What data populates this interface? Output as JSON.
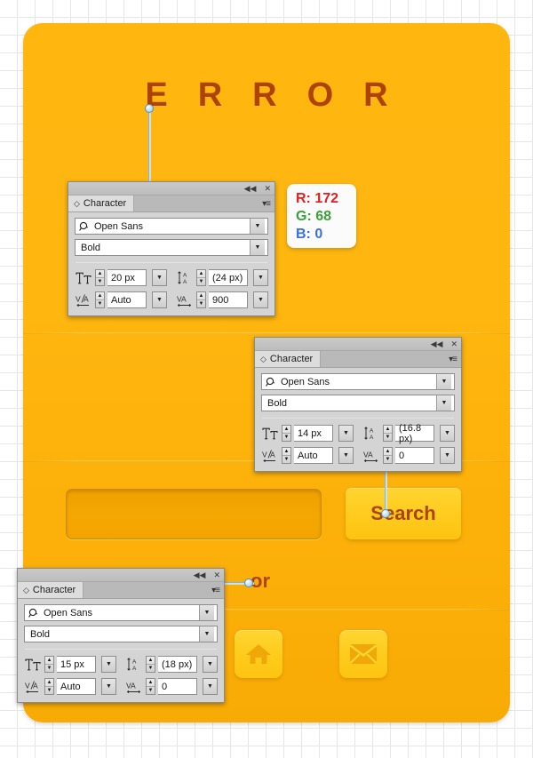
{
  "canvas": {
    "grid_enabled": true,
    "grid_size_px": 20,
    "background": "#ffffff",
    "grid_color": "#e6e6e6"
  },
  "card": {
    "background_color": "#ffb710",
    "accent_text_color": "#ac4400",
    "button_color": "#ffcb1d"
  },
  "error": {
    "heading": "ERROR"
  },
  "rgb_swatch": {
    "r_label": "R: 172",
    "g_label": "G: 68",
    "b_label": "B: 0",
    "r_color": "#e02020",
    "g_color": "#3aa03a",
    "b_color": "#3a6fe0",
    "hex": "#ac4400"
  },
  "search": {
    "input_value": "",
    "input_placeholder": "",
    "button_label": "Search"
  },
  "or_label": "or",
  "icon_tiles": [
    {
      "name": "home-icon",
      "label": "Home"
    },
    {
      "name": "envelope-icon",
      "label": "Email"
    }
  ],
  "panels": [
    {
      "title": "Character",
      "collapse_icon": "◀◀",
      "close_icon": "✕",
      "menu_icon": "▾≡",
      "tab_diamond": "◇",
      "font_family": "Open Sans",
      "font_style": "Bold",
      "font_size": "20 px",
      "leading": "(24 px)",
      "kerning": "Auto",
      "tracking": "900",
      "size_icon": "TT",
      "leading_icon": "A̲A",
      "kerning_icon": "V/A",
      "tracking_icon": "VA",
      "dropdown_arrow": "▼",
      "spin_up": "▲",
      "spin_down": "▼",
      "search_glyph": "⚲"
    },
    {
      "title": "Character",
      "collapse_icon": "◀◀",
      "close_icon": "✕",
      "menu_icon": "▾≡",
      "tab_diamond": "◇",
      "font_family": "Open Sans",
      "font_style": "Bold",
      "font_size": "14 px",
      "leading": "(16.8 px)",
      "kerning": "Auto",
      "tracking": "0",
      "size_icon": "TT",
      "leading_icon": "A̲A",
      "kerning_icon": "V/A",
      "tracking_icon": "VA",
      "dropdown_arrow": "▼",
      "spin_up": "▲",
      "spin_down": "▼",
      "search_glyph": "⚲"
    },
    {
      "title": "Character",
      "collapse_icon": "◀◀",
      "close_icon": "✕",
      "menu_icon": "▾≡",
      "tab_diamond": "◇",
      "font_family": "Open Sans",
      "font_style": "Bold",
      "font_size": "15 px",
      "leading": "(18 px)",
      "kerning": "Auto",
      "tracking": "0",
      "size_icon": "TT",
      "leading_icon": "A̲A",
      "kerning_icon": "V/A",
      "tracking_icon": "VA",
      "dropdown_arrow": "▼",
      "spin_up": "▲",
      "spin_down": "▼",
      "search_glyph": "⚲"
    }
  ]
}
